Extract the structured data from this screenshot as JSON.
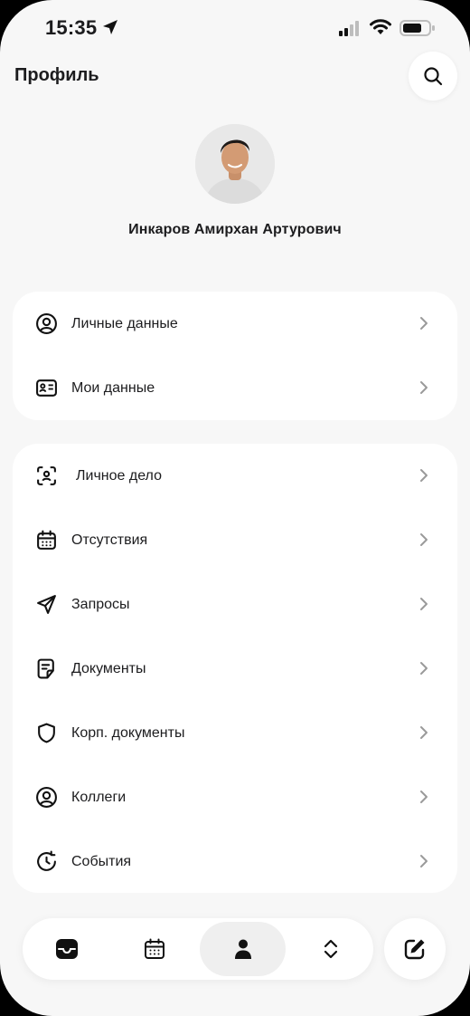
{
  "status_bar": {
    "time": "15:35"
  },
  "header": {
    "title": "Профиль"
  },
  "profile": {
    "name": "Инкаров Амирхан Артурович"
  },
  "menu_group_1": [
    {
      "label": "Личные данные",
      "icon": "user-circle-icon"
    },
    {
      "label": "Мои данные",
      "icon": "id-card-icon"
    }
  ],
  "menu_group_2": [
    {
      "label": "Личное дело",
      "icon": "face-scan-icon"
    },
    {
      "label": "Отсутствия",
      "icon": "calendar-icon"
    },
    {
      "label": "Запросы",
      "icon": "send-icon"
    },
    {
      "label": "Документы",
      "icon": "document-icon"
    },
    {
      "label": "Корп. документы",
      "icon": "shield-icon"
    },
    {
      "label": "Коллеги",
      "icon": "user-circle-icon"
    },
    {
      "label": "События",
      "icon": "clock-icon"
    }
  ],
  "tab_bar": {
    "tabs": [
      {
        "icon": "inbox-icon"
      },
      {
        "icon": "calendar-icon"
      },
      {
        "icon": "person-icon",
        "active": true
      },
      {
        "icon": "chevron-up-down-icon"
      }
    ]
  },
  "actions": {
    "compose_icon": "compose-icon",
    "search_icon": "search-icon"
  }
}
